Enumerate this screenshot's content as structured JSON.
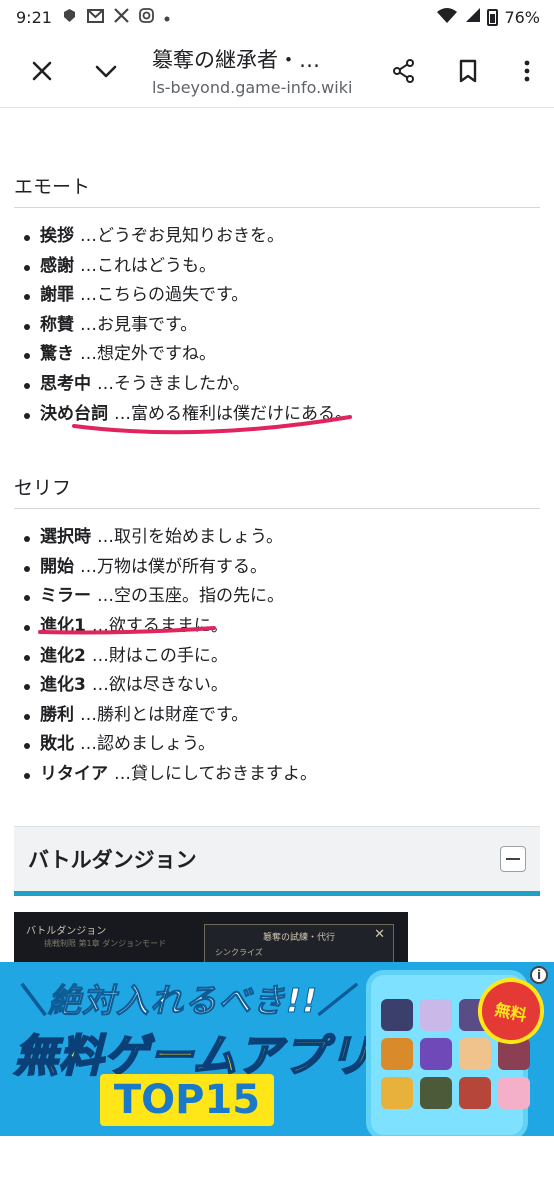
{
  "status_bar": {
    "time": "9:21",
    "battery": "76%",
    "notification_icons": [
      "shield-icon",
      "gmail-icon",
      "x-icon",
      "instagram-icon",
      "dot-icon"
    ]
  },
  "toolbar": {
    "title": "簒奪の継承者・…",
    "url": "ls-beyond.game-info.wiki"
  },
  "emote": {
    "heading": "エモート",
    "items": [
      {
        "label": "挨拶",
        "text": "…どうぞお見知りおきを。"
      },
      {
        "label": "感謝",
        "text": "…これはどうも。"
      },
      {
        "label": "謝罪",
        "text": "…こちらの過失です。"
      },
      {
        "label": "称賛",
        "text": "…お見事です。"
      },
      {
        "label": "驚き",
        "text": "…想定外ですね。"
      },
      {
        "label": "思考中",
        "text": "…そうきましたか。"
      },
      {
        "label": "決め台詞",
        "text": "…富める権利は僕だけにある。"
      }
    ]
  },
  "serif": {
    "heading": "セリフ",
    "items": [
      {
        "label": "選択時",
        "text": "…取引を始めましょう。"
      },
      {
        "label": "開始",
        "text": "…万物は僕が所有する。"
      },
      {
        "label": "ミラー",
        "text": "…空の玉座。指の先に。"
      },
      {
        "label": "進化1",
        "text": "…欲するままに。"
      },
      {
        "label": "進化2",
        "text": "…財はこの手に。"
      },
      {
        "label": "進化3",
        "text": "…欲は尽きない。"
      },
      {
        "label": "勝利",
        "text": "…勝利とは財産です。"
      },
      {
        "label": "敗北",
        "text": "…認めましょう。"
      },
      {
        "label": "リタイア",
        "text": "…貸しにしておきますよ。"
      }
    ]
  },
  "battle_dungeon": {
    "title": "バトルダンジョン",
    "screenshot": {
      "header": "バトルダンジョン",
      "subline": "挑戦制限 第1章 ダンジョンモード",
      "panel_title": "簒奪の試練・代行",
      "panel_close": "✕",
      "panel_row": "シンクライズ"
    }
  },
  "ad": {
    "line1": "＼絶対入れるべき!!／",
    "line2": "無料ゲームアプリ",
    "badge": "TOP15",
    "corner": "無料",
    "info": "i",
    "app_colors": [
      "#3b3f6b",
      "#c9b8e8",
      "#5a4c86",
      "#2d6fa8",
      "#d98a2a",
      "#6f49b8",
      "#f0c38c",
      "#8b3f52",
      "#e8b13c",
      "#4d5a3a",
      "#b7463a",
      "#f3b0c8"
    ]
  },
  "annotations": {
    "underline_color": "#e0245e"
  }
}
